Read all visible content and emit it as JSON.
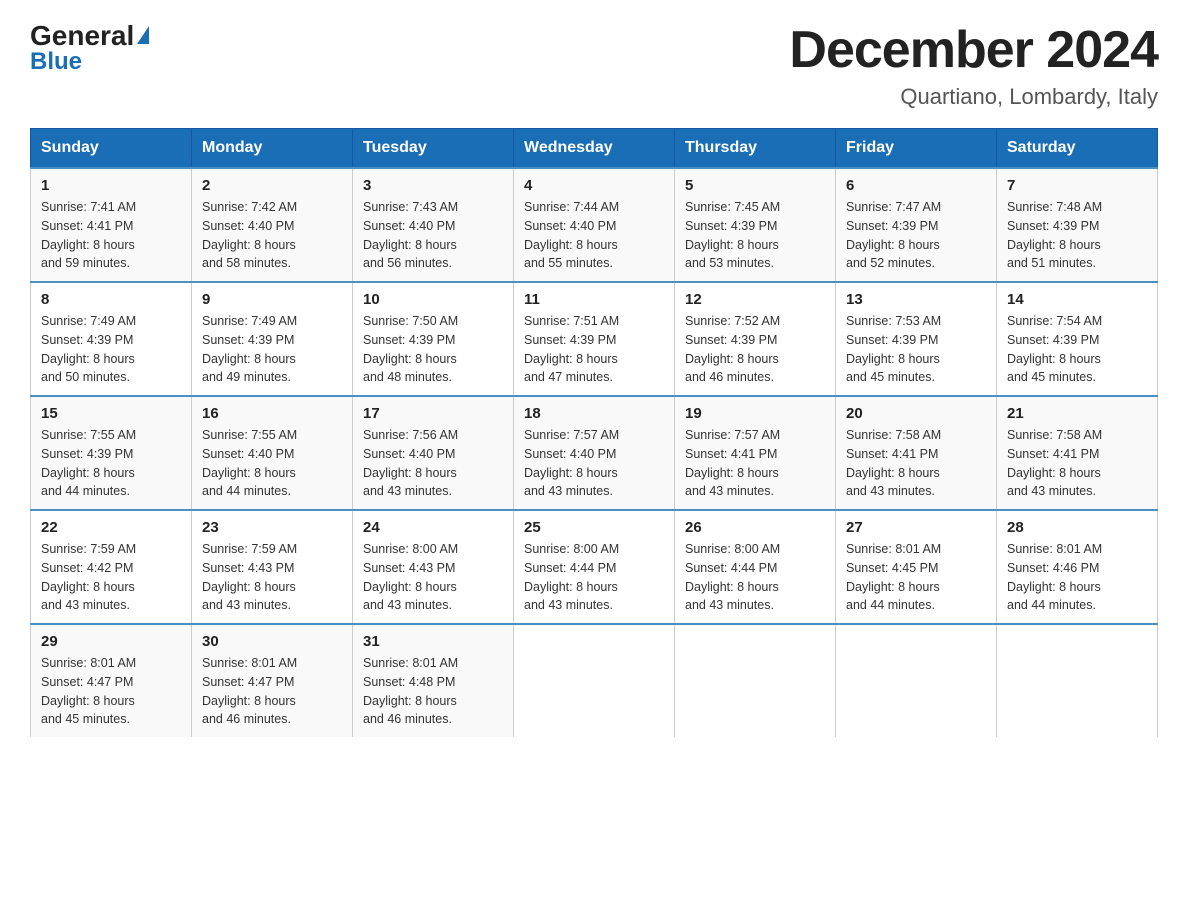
{
  "header": {
    "logo_general": "General",
    "logo_blue": "Blue",
    "title": "December 2024",
    "subtitle": "Quartiano, Lombardy, Italy"
  },
  "days_of_week": [
    "Sunday",
    "Monday",
    "Tuesday",
    "Wednesday",
    "Thursday",
    "Friday",
    "Saturday"
  ],
  "weeks": [
    [
      {
        "day": "1",
        "sunrise": "7:41 AM",
        "sunset": "4:41 PM",
        "daylight": "8 hours and 59 minutes."
      },
      {
        "day": "2",
        "sunrise": "7:42 AM",
        "sunset": "4:40 PM",
        "daylight": "8 hours and 58 minutes."
      },
      {
        "day": "3",
        "sunrise": "7:43 AM",
        "sunset": "4:40 PM",
        "daylight": "8 hours and 56 minutes."
      },
      {
        "day": "4",
        "sunrise": "7:44 AM",
        "sunset": "4:40 PM",
        "daylight": "8 hours and 55 minutes."
      },
      {
        "day": "5",
        "sunrise": "7:45 AM",
        "sunset": "4:39 PM",
        "daylight": "8 hours and 53 minutes."
      },
      {
        "day": "6",
        "sunrise": "7:47 AM",
        "sunset": "4:39 PM",
        "daylight": "8 hours and 52 minutes."
      },
      {
        "day": "7",
        "sunrise": "7:48 AM",
        "sunset": "4:39 PM",
        "daylight": "8 hours and 51 minutes."
      }
    ],
    [
      {
        "day": "8",
        "sunrise": "7:49 AM",
        "sunset": "4:39 PM",
        "daylight": "8 hours and 50 minutes."
      },
      {
        "day": "9",
        "sunrise": "7:49 AM",
        "sunset": "4:39 PM",
        "daylight": "8 hours and 49 minutes."
      },
      {
        "day": "10",
        "sunrise": "7:50 AM",
        "sunset": "4:39 PM",
        "daylight": "8 hours and 48 minutes."
      },
      {
        "day": "11",
        "sunrise": "7:51 AM",
        "sunset": "4:39 PM",
        "daylight": "8 hours and 47 minutes."
      },
      {
        "day": "12",
        "sunrise": "7:52 AM",
        "sunset": "4:39 PM",
        "daylight": "8 hours and 46 minutes."
      },
      {
        "day": "13",
        "sunrise": "7:53 AM",
        "sunset": "4:39 PM",
        "daylight": "8 hours and 45 minutes."
      },
      {
        "day": "14",
        "sunrise": "7:54 AM",
        "sunset": "4:39 PM",
        "daylight": "8 hours and 45 minutes."
      }
    ],
    [
      {
        "day": "15",
        "sunrise": "7:55 AM",
        "sunset": "4:39 PM",
        "daylight": "8 hours and 44 minutes."
      },
      {
        "day": "16",
        "sunrise": "7:55 AM",
        "sunset": "4:40 PM",
        "daylight": "8 hours and 44 minutes."
      },
      {
        "day": "17",
        "sunrise": "7:56 AM",
        "sunset": "4:40 PM",
        "daylight": "8 hours and 43 minutes."
      },
      {
        "day": "18",
        "sunrise": "7:57 AM",
        "sunset": "4:40 PM",
        "daylight": "8 hours and 43 minutes."
      },
      {
        "day": "19",
        "sunrise": "7:57 AM",
        "sunset": "4:41 PM",
        "daylight": "8 hours and 43 minutes."
      },
      {
        "day": "20",
        "sunrise": "7:58 AM",
        "sunset": "4:41 PM",
        "daylight": "8 hours and 43 minutes."
      },
      {
        "day": "21",
        "sunrise": "7:58 AM",
        "sunset": "4:41 PM",
        "daylight": "8 hours and 43 minutes."
      }
    ],
    [
      {
        "day": "22",
        "sunrise": "7:59 AM",
        "sunset": "4:42 PM",
        "daylight": "8 hours and 43 minutes."
      },
      {
        "day": "23",
        "sunrise": "7:59 AM",
        "sunset": "4:43 PM",
        "daylight": "8 hours and 43 minutes."
      },
      {
        "day": "24",
        "sunrise": "8:00 AM",
        "sunset": "4:43 PM",
        "daylight": "8 hours and 43 minutes."
      },
      {
        "day": "25",
        "sunrise": "8:00 AM",
        "sunset": "4:44 PM",
        "daylight": "8 hours and 43 minutes."
      },
      {
        "day": "26",
        "sunrise": "8:00 AM",
        "sunset": "4:44 PM",
        "daylight": "8 hours and 43 minutes."
      },
      {
        "day": "27",
        "sunrise": "8:01 AM",
        "sunset": "4:45 PM",
        "daylight": "8 hours and 44 minutes."
      },
      {
        "day": "28",
        "sunrise": "8:01 AM",
        "sunset": "4:46 PM",
        "daylight": "8 hours and 44 minutes."
      }
    ],
    [
      {
        "day": "29",
        "sunrise": "8:01 AM",
        "sunset": "4:47 PM",
        "daylight": "8 hours and 45 minutes."
      },
      {
        "day": "30",
        "sunrise": "8:01 AM",
        "sunset": "4:47 PM",
        "daylight": "8 hours and 46 minutes."
      },
      {
        "day": "31",
        "sunrise": "8:01 AM",
        "sunset": "4:48 PM",
        "daylight": "8 hours and 46 minutes."
      },
      null,
      null,
      null,
      null
    ]
  ],
  "labels": {
    "sunrise": "Sunrise:",
    "sunset": "Sunset:",
    "daylight": "Daylight:"
  },
  "colors": {
    "header_bg": "#1a6eb5",
    "header_text": "#ffffff",
    "border_top": "#4a90c4"
  }
}
